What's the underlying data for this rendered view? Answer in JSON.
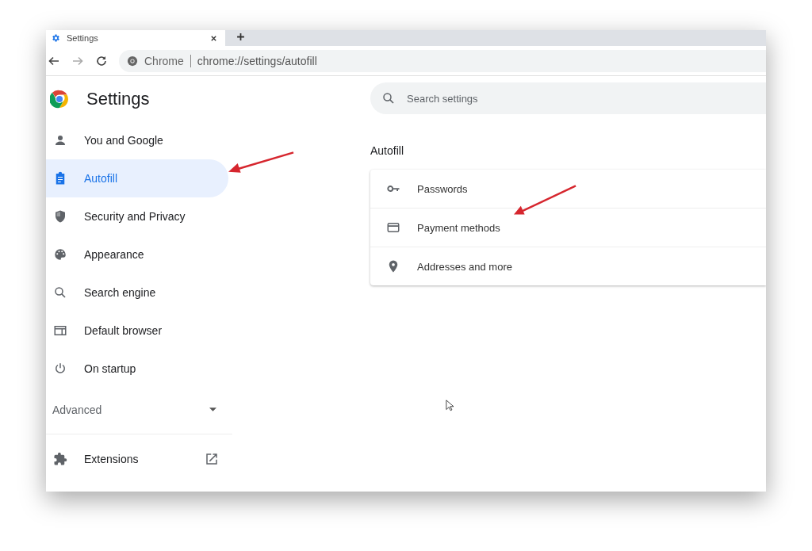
{
  "tab": {
    "title": "Settings"
  },
  "toolbar": {
    "site_chip": "Chrome",
    "url": "chrome://settings/autofill"
  },
  "header": {
    "title": "Settings"
  },
  "sidebar": {
    "items": [
      {
        "label": "You and Google",
        "kind": "person",
        "selected": false
      },
      {
        "label": "Autofill",
        "kind": "clipboard",
        "selected": true
      },
      {
        "label": "Security and Privacy",
        "kind": "shield",
        "selected": false
      },
      {
        "label": "Appearance",
        "kind": "palette",
        "selected": false
      },
      {
        "label": "Search engine",
        "kind": "search",
        "selected": false
      },
      {
        "label": "Default browser",
        "kind": "browser",
        "selected": false
      },
      {
        "label": "On startup",
        "kind": "power",
        "selected": false
      }
    ],
    "advanced": {
      "label": "Advanced",
      "expanded": false
    },
    "extensions": {
      "label": "Extensions"
    }
  },
  "search": {
    "placeholder": "Search settings"
  },
  "section": {
    "title": "Autofill",
    "rows": [
      {
        "label": "Passwords",
        "kind": "key"
      },
      {
        "label": "Payment methods",
        "kind": "card"
      },
      {
        "label": "Addresses and more",
        "kind": "pin"
      }
    ]
  }
}
